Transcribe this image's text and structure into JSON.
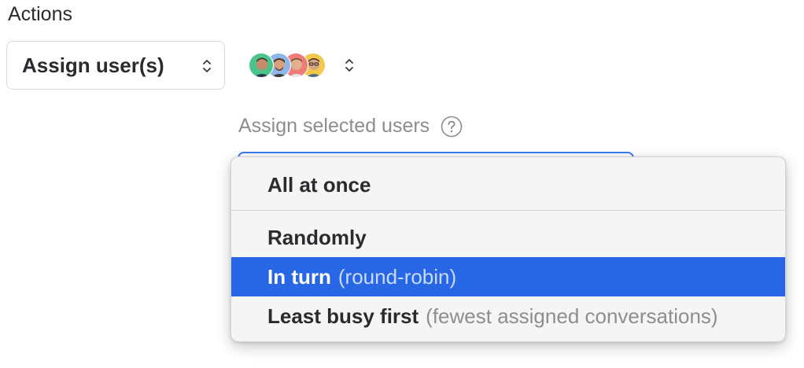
{
  "section": {
    "title": "Actions"
  },
  "action_select": {
    "value": "Assign user(s)",
    "icon": "chevron-updown-icon"
  },
  "assignees": {
    "avatars": [
      {
        "name": "user-avatar",
        "bg": "#4cc38a"
      },
      {
        "name": "user-avatar",
        "bg": "#8fb6e8"
      },
      {
        "name": "user-avatar",
        "bg": "#ee7b76"
      },
      {
        "name": "user-avatar",
        "bg": "#f2c94c"
      }
    ],
    "icon": "chevron-updown-icon"
  },
  "assign_mode": {
    "label": "Assign selected users",
    "help_icon": "help-icon",
    "focus_color": "#3b7bf0"
  },
  "dropdown": {
    "highlight_color": "#2767e6",
    "options": [
      {
        "label": "All at once",
        "hint": ""
      },
      {
        "label": "Randomly",
        "hint": ""
      },
      {
        "label": "In turn",
        "hint": "(round-robin)"
      },
      {
        "label": "Least busy first",
        "hint": "(fewest assigned conversations)"
      }
    ],
    "highlighted_index": 2
  }
}
